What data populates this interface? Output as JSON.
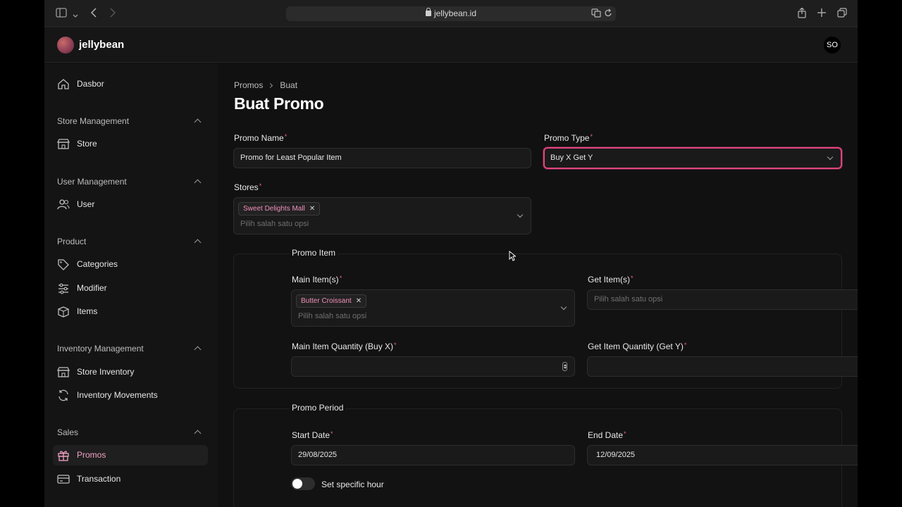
{
  "browser": {
    "url": "jellybean.id",
    "icons": [
      "sidebar-toggle-icon",
      "back-icon",
      "forward-icon",
      "translate-icon",
      "reload-icon",
      "share-icon",
      "new-tab-icon",
      "tabs-overview-icon"
    ]
  },
  "app": {
    "brand": "jellybean",
    "avatar_initials": "SO"
  },
  "sidebar": {
    "dashboard": "Dasbor",
    "sections": [
      {
        "title": "Store Management",
        "items": [
          "Store"
        ]
      },
      {
        "title": "User Management",
        "items": [
          "User"
        ]
      },
      {
        "title": "Product",
        "items": [
          "Categories",
          "Modifier",
          "Items"
        ]
      },
      {
        "title": "Inventory Management",
        "items": [
          "Store Inventory",
          "Inventory Movements"
        ]
      },
      {
        "title": "Sales",
        "items": [
          "Promos",
          "Transaction"
        ]
      }
    ],
    "active_item": "Promos"
  },
  "breadcrumb": {
    "parent": "Promos",
    "current": "Buat"
  },
  "page_title": "Buat Promo",
  "form": {
    "promo_name": {
      "label": "Promo Name",
      "value": "Promo for Least Popular Item"
    },
    "promo_type": {
      "label": "Promo Type",
      "value": "Buy X Get Y"
    },
    "stores": {
      "label": "Stores",
      "chips": [
        "Sweet Delights Mall"
      ],
      "placeholder": "Pilih salah satu opsi"
    },
    "promo_item": {
      "legend": "Promo Item",
      "main_items": {
        "label": "Main Item(s)",
        "chips": [
          "Butter Croissant"
        ],
        "placeholder": "Pilih salah satu opsi"
      },
      "get_items": {
        "label": "Get Item(s)",
        "placeholder": "Pilih salah satu opsi"
      },
      "main_qty": {
        "label": "Main Item Quantity (Buy X)",
        "value": ""
      },
      "get_qty": {
        "label": "Get Item Quantity (Get Y)",
        "value": ""
      }
    },
    "promo_period": {
      "legend": "Promo Period",
      "start_date": {
        "label": "Start Date",
        "value": "29/08/2025"
      },
      "end_date": {
        "label": "End Date",
        "value": "12/09/2025"
      },
      "specific_hour": {
        "label": "Set specific hour",
        "enabled": false
      }
    }
  },
  "colors": {
    "accent": "#e0457f",
    "chip_text": "#f08fb8",
    "active_nav_text": "#f0a2c3"
  }
}
